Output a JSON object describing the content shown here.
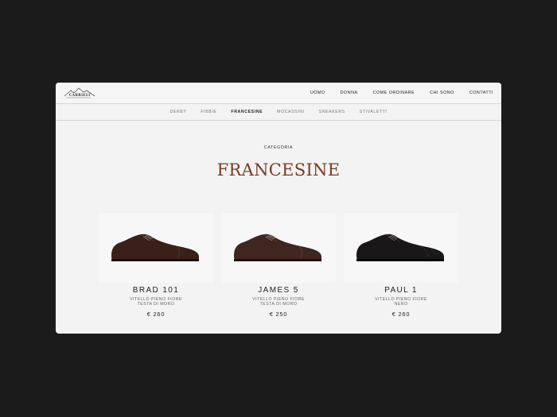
{
  "brand": {
    "logo_text": "CARRIELI"
  },
  "nav": [
    "UOMO",
    "DONNA",
    "COME ORDINARE",
    "CHI SONO",
    "CONTATTI"
  ],
  "subnav": [
    "DERBY",
    "FIBBIE",
    "FRANCESINE",
    "MOCASSINI",
    "SNEAKERS",
    "STIVALETTI"
  ],
  "subnav_active": "FRANCESINE",
  "page": {
    "eyebrow": "CATEGORIA",
    "title": "FRANCESINE"
  },
  "products": [
    {
      "name": "BRAD 101",
      "desc1": "VITELLO PIENO FIORE",
      "desc2": "TESTA DI MORO",
      "price": "€ 260",
      "color": "#3b201a"
    },
    {
      "name": "JAMES 5",
      "desc1": "VITELLO PIENO FIORE",
      "desc2": "TESTA DI MORO",
      "price": "€ 250",
      "color": "#3f2621"
    },
    {
      "name": "PAUL 1",
      "desc1": "VITELLO PIENO FIORE",
      "desc2": "NERO",
      "price": "€ 260",
      "color": "#1a1718"
    }
  ],
  "colors": {
    "title": "#7a3a22",
    "background": "#f3f3f3",
    "page_backdrop": "#1b1b1b"
  }
}
